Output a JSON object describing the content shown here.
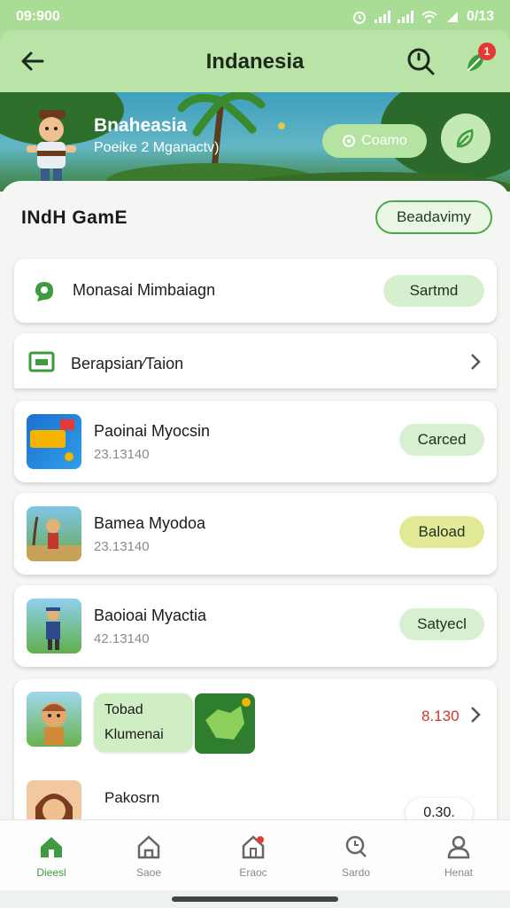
{
  "status": {
    "time": "09:900",
    "right": "0/13"
  },
  "header": {
    "title": "Indanesia",
    "badge": "1"
  },
  "hero": {
    "title": "Bnaheasia",
    "subtitle": "Poeike 2 Mganactv)",
    "button_label": "Coamo"
  },
  "section": {
    "title": "INdH GamE",
    "button_label": "Beadavimy"
  },
  "promo_card": {
    "label": "Monasai Mimbaiagn",
    "button_label": "Sartmd"
  },
  "category_row": {
    "label": "Berapsian⁄Taion"
  },
  "games": [
    {
      "name": "Paoinai Myocsin",
      "meta": "23.13140",
      "button_label": "Carced",
      "button_color": "#d7f0cf"
    },
    {
      "name": "Bamea Myodoa",
      "meta": "23.13140",
      "button_label": "Baload",
      "button_color": "#e3ea97"
    },
    {
      "name": "Baoioai Myactia",
      "meta": "42.13140",
      "button_label": "Satyecl",
      "button_color": "#d7f0cf"
    }
  ],
  "feature_card": {
    "tag_line1": "Tobad",
    "tag_line2": "Klumenai",
    "price": "8.130"
  },
  "partial_card": {
    "name": "Pakosrn",
    "value": "0.30."
  },
  "nav": [
    {
      "label": "Dieesl",
      "icon": "home-icon"
    },
    {
      "label": "Saoe",
      "icon": "store-icon"
    },
    {
      "label": "Eraoc",
      "icon": "notification-icon"
    },
    {
      "label": "Sardo",
      "icon": "search-icon"
    },
    {
      "label": "Henat",
      "icon": "profile-icon"
    }
  ],
  "colors": {
    "accent": "#4aa84a",
    "header": "#b9e3a7",
    "price": "#d0342c"
  }
}
